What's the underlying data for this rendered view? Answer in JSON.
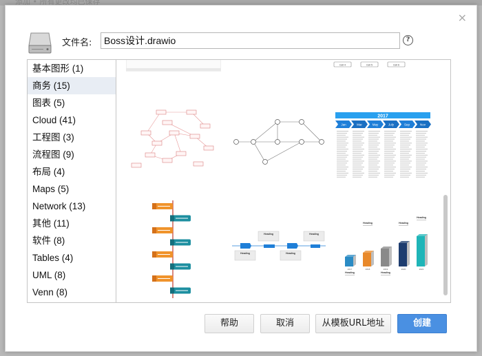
{
  "backdrop_text": "添加 • 所有更改均已保存",
  "dialog": {
    "filename_label": "文件名:",
    "filename_value": "Boss设计.drawio",
    "help_symbol": "?",
    "close_symbol": "×"
  },
  "categories": [
    {
      "label": "基本图形 (1)"
    },
    {
      "label": "商务 (15)"
    },
    {
      "label": "图表 (5)"
    },
    {
      "label": "Cloud (41)"
    },
    {
      "label": "工程图 (3)"
    },
    {
      "label": "流程图 (9)"
    },
    {
      "label": "布局 (4)"
    },
    {
      "label": "Maps (5)"
    },
    {
      "label": "Network (13)"
    },
    {
      "label": "其他 (11)"
    },
    {
      "label": "软件 (8)"
    },
    {
      "label": "Tables (4)"
    },
    {
      "label": "UML (8)"
    },
    {
      "label": "Venn (8)"
    }
  ],
  "selected_category": "商务 (15)",
  "templates": {
    "row0_cells": [
      "Cell 4",
      "Cell 5",
      "Cell 6"
    ],
    "timeline": {
      "year": "2017",
      "months": [
        "Jan",
        "Mar",
        "May",
        "July",
        "Sep",
        "Nov"
      ]
    },
    "heading": "Heading",
    "bar_years": [
      "2017",
      "2018",
      "2019",
      "2020",
      "2021"
    ]
  },
  "buttons": {
    "help": "帮助",
    "cancel": "取消",
    "from_url": "从模板URL地址",
    "create": "创建"
  },
  "colors": {
    "primary_button": "#4a90e2",
    "selected_row": "#e8edf4",
    "timeline_blue": "#1f7fd8",
    "step_orange": "#f0932b",
    "step_teal": "#1d8fa0"
  }
}
